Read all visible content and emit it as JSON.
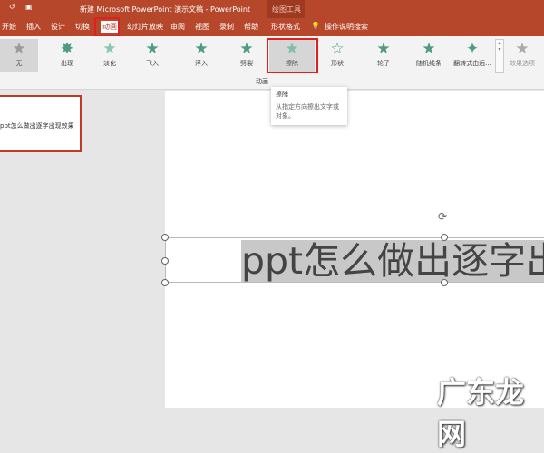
{
  "titlebar": {
    "title": "新建 Microsoft PowerPoint 演示文稿 - PowerPoint",
    "context": "绘图工具"
  },
  "tabs": [
    "开始",
    "插入",
    "设计",
    "切换",
    "动画",
    "幻灯片放映",
    "审阅",
    "视图",
    "录制",
    "帮助",
    "形状格式"
  ],
  "search": "操作说明搜索",
  "animations": [
    "无",
    "出现",
    "淡化",
    "飞入",
    "浮入",
    "劈裂",
    "擦除",
    "形状",
    "轮子",
    "随机线条",
    "翻转式由远..."
  ],
  "effect_options": "效果选项",
  "group_label": "动画",
  "tooltip": {
    "title": "擦除",
    "desc": "从指定方向擦出文字或对象。"
  },
  "thumbnail_text": "ppt怎么做出逐字出现效果",
  "slide_text": "ppt怎么做出逐字出",
  "watermark": "广东龙网"
}
